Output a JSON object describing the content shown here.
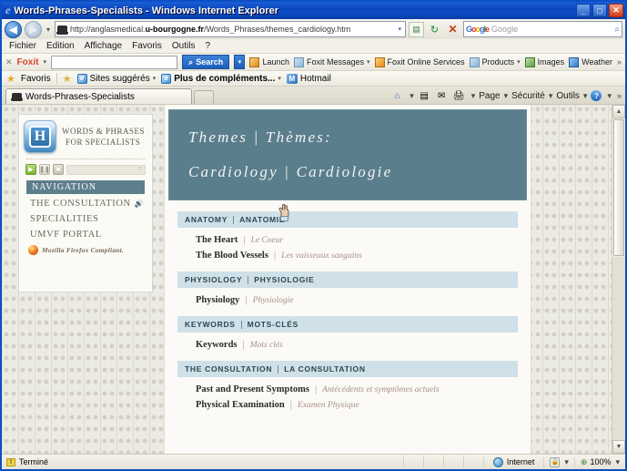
{
  "window": {
    "title": "Words-Phrases-Specialists - Windows Internet Explorer",
    "minimize": "_",
    "maximize": "□",
    "close": "✕"
  },
  "browser": {
    "address": {
      "url_prefix": "http://anglasmedical.",
      "url_domain": "u-bourgogne.fr",
      "url_suffix": "/Words_Phrases/themes_cardiology.htm",
      "dropdown_caret": "▾"
    },
    "search": {
      "placeholder": "Google",
      "g": [
        "G",
        "o",
        "o",
        "g",
        "l",
        "e"
      ],
      "button": "⌕"
    },
    "nav": {
      "back": "◀",
      "forward": "▶",
      "history_caret": "▾",
      "rss": "▤",
      "refresh": "↻",
      "stop": "✕"
    },
    "menus": [
      "Fichier",
      "Edition",
      "Affichage",
      "Favoris",
      "Outils",
      "?"
    ],
    "foxit": {
      "close": "✕",
      "brand": "Foxit",
      "brand_caret": "▾",
      "input_value": "",
      "search_label": "Search",
      "search_icon": "🔍",
      "search_caret": "▾",
      "items": [
        {
          "label": "Launch",
          "caret": ""
        },
        {
          "label": "Foxit Messages",
          "caret": "▾"
        },
        {
          "label": "Foxit Online Services",
          "caret": ""
        },
        {
          "label": "Products",
          "caret": "▾"
        },
        {
          "label": "Images",
          "caret": ""
        },
        {
          "label": "Weather",
          "caret": ""
        }
      ],
      "overflow": "»"
    },
    "favorites": {
      "label": "Favoris",
      "star": "★",
      "items": [
        {
          "label": "Sites suggérés",
          "caret": "▾",
          "icon": "star"
        },
        {
          "label": "Plus de compléments...",
          "caret": "▾",
          "icon": "ie",
          "bold": true
        },
        {
          "label": "Hotmail",
          "caret": "",
          "icon": "mail"
        }
      ]
    },
    "tab": {
      "title": "Words-Phrases-Specialists"
    },
    "command_bar": {
      "home_icon": "⌂",
      "feeds_icon": "▤",
      "mail_icon": "✉",
      "print_icon": "🖨",
      "items": [
        "Page",
        "Sécurité",
        "Outils"
      ],
      "help": "?",
      "caret": "▾",
      "overflow": "»"
    }
  },
  "page": {
    "sidebar": {
      "logo_letter": "H",
      "brand_line1": "WORDS & PHRASES",
      "brand_line2": "FOR SPECIALISTS",
      "player": {
        "play": "▶",
        "pause": "❚❚",
        "stop": "■",
        "track_text": "?"
      },
      "nav_header": "NAVIGATION",
      "links": [
        {
          "label": "THE CONSULTATION",
          "speaker": "🔊"
        },
        {
          "label": "SPECIALITIES",
          "speaker": ""
        },
        {
          "label": "UMVF PORTAL",
          "speaker": ""
        }
      ],
      "firefox_note": "Mozilla Firefox Compliant."
    },
    "hero": {
      "line1": "Themes | Thèmes:",
      "line2": "Cardiology | Cardiologie"
    },
    "sections": [
      {
        "header_en": "ANATOMY",
        "header_fr": "ANATOMIE",
        "rows": [
          {
            "en": "The Heart",
            "fr": "Le Coeur"
          },
          {
            "en": "The Blood Vessels",
            "fr": "Les vaisseaux sanguins"
          }
        ]
      },
      {
        "header_en": "PHYSIOLOGY",
        "header_fr": "PHYSIOLOGIE",
        "rows": [
          {
            "en": "Physiology",
            "fr": "Physiologie"
          }
        ]
      },
      {
        "header_en": "KEYWORDS",
        "header_fr": "MOTS-CLÉS",
        "rows": [
          {
            "en": "Keywords",
            "fr": "Mots clés"
          }
        ]
      },
      {
        "header_en": "THE CONSULTATION",
        "header_fr": "LA CONSULTATION",
        "rows": [
          {
            "en": "Past and Present Symptoms",
            "fr": "Antécédents et symptômes actuels"
          },
          {
            "en": "Physical Examination",
            "fr": "Examen Physique"
          }
        ]
      }
    ]
  },
  "status": {
    "text": "Terminé",
    "zone": "Internet",
    "zoom": "100%",
    "caret": "▾",
    "warn": "!"
  }
}
